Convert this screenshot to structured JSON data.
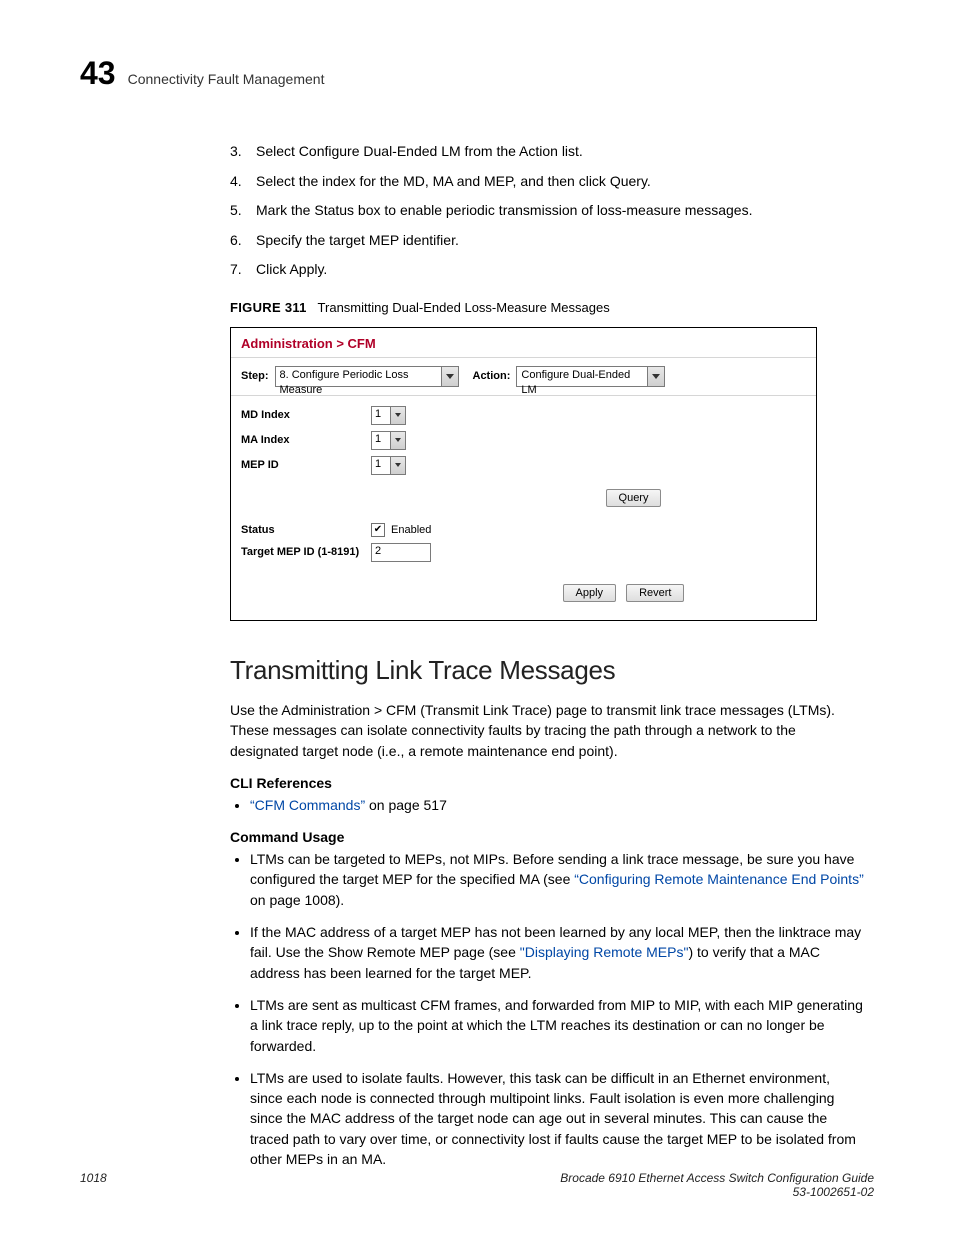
{
  "header": {
    "chapter_number": "43",
    "chapter_title": "Connectivity Fault Management"
  },
  "steps": [
    {
      "n": "3.",
      "text": "Select Configure Dual-Ended LM from the Action list."
    },
    {
      "n": "4.",
      "text": "Select the index for the MD, MA and MEP, and then click Query."
    },
    {
      "n": "5.",
      "text": "Mark the Status box to enable periodic transmission of loss-measure messages."
    },
    {
      "n": "6.",
      "text": "Specify the target MEP identifier."
    },
    {
      "n": "7.",
      "text": "Click Apply."
    }
  ],
  "figure": {
    "label": "FIGURE 311",
    "caption": "Transmitting Dual-Ended Loss-Measure Messages",
    "breadcrumb": "Administration > CFM",
    "step_label": "Step:",
    "step_value": "8. Configure Periodic Loss Measure",
    "action_label": "Action:",
    "action_value": "Configure Dual-Ended LM",
    "md_index_label": "MD Index",
    "md_index_value": "1",
    "ma_index_label": "MA Index",
    "ma_index_value": "1",
    "mep_id_label": "MEP ID",
    "mep_id_value": "1",
    "query_btn": "Query",
    "status_label": "Status",
    "status_value": "Enabled",
    "target_label": "Target MEP ID (1-8191)",
    "target_value": "2",
    "apply_btn": "Apply",
    "revert_btn": "Revert"
  },
  "section_heading": "Transmitting Link Trace Messages",
  "body_para": "Use the Administration > CFM (Transmit Link Trace) page to transmit link trace messages (LTMs). These messages can isolate connectivity faults by tracing the path through a network to the designated target node (i.e., a remote maintenance end point).",
  "cli_ref_heading": "CLI References",
  "cli_ref_link": "“CFM Commands”",
  "cli_ref_tail": " on page 517",
  "cmd_usage_heading": "Command Usage",
  "bullets": {
    "b1_a": "LTMs can be targeted to MEPs, not MIPs. Before sending a link trace message, be sure you have configured the target MEP for the specified MA (see ",
    "b1_link": "“Configuring Remote Maintenance End Points”",
    "b1_b": " on page 1008).",
    "b2_a": "If the MAC address of a target MEP has not been learned by any local MEP, then the linktrace may fail. Use the Show Remote MEP page (see ",
    "b2_link": "\"Displaying Remote MEPs\"",
    "b2_b": ") to verify that a MAC address has been learned for the target MEP.",
    "b3": "LTMs are sent as multicast CFM frames, and forwarded from MIP to MIP, with each MIP generating a link trace reply, up to the point at which the LTM reaches its destination or can no longer be forwarded.",
    "b4": "LTMs are used to isolate faults. However, this task can be difficult in an Ethernet environment, since each node is connected through multipoint links. Fault isolation is even more challenging since the MAC address of the target node can age out in several minutes. This can cause the traced path to vary over time, or connectivity lost if faults cause the target MEP to be isolated from other MEPs in an MA."
  },
  "footer": {
    "page_number": "1018",
    "doc_title": "Brocade 6910 Ethernet Access Switch Configuration Guide",
    "doc_number": "53-1002651-02"
  }
}
